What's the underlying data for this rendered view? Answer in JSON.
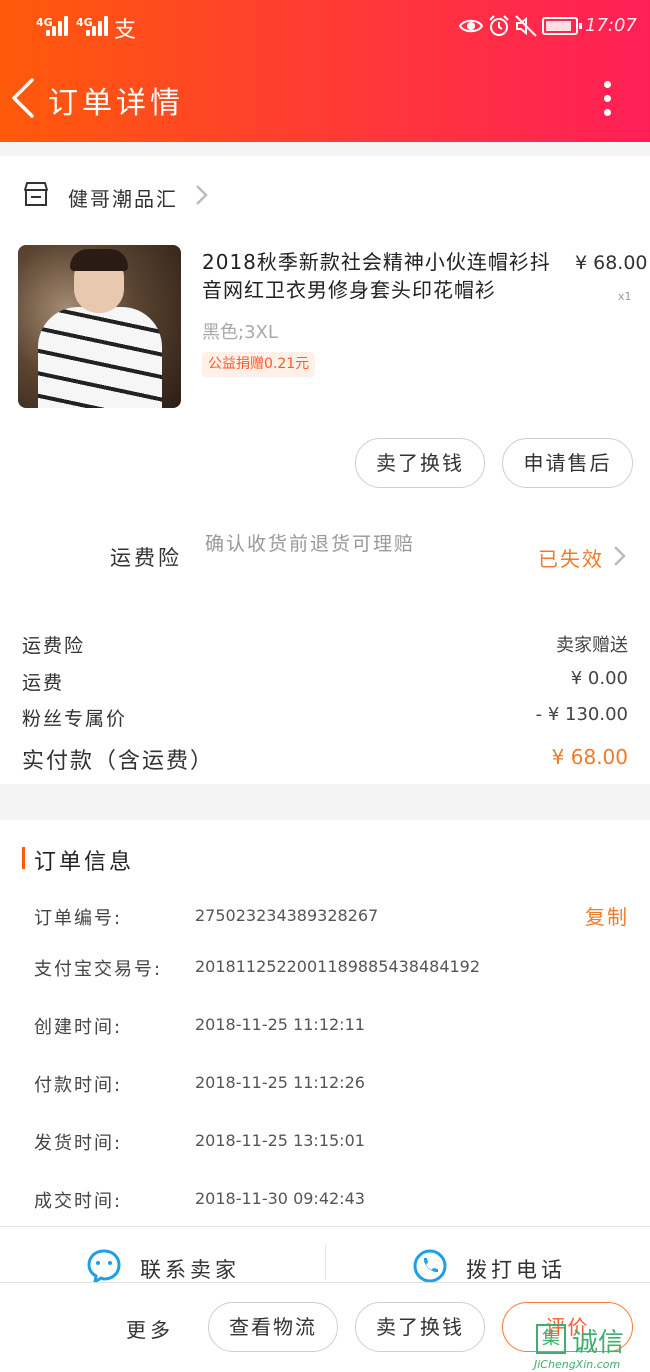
{
  "status_bar": {
    "signal_1": "4G",
    "signal_2": "4G",
    "alipay_glyph": "支",
    "battery_level": "88",
    "time": "17:07",
    "icons": [
      "eye-icon",
      "alarm-icon",
      "mute-icon",
      "battery-icon"
    ]
  },
  "nav": {
    "title": "订单详情",
    "icons": [
      "back-arrow-icon",
      "more-vertical-icon"
    ]
  },
  "shop": {
    "name": "健哥潮品汇",
    "icon": "store-icon"
  },
  "product": {
    "title": "2018秋季新款社会精神小伙连帽衫抖音网红卫衣男修身套头印花帽衫",
    "price": "¥ 68.00",
    "quantity": "x1",
    "sku": "黑色;3XL",
    "charity_badge": "公益捐赠0.21元"
  },
  "item_actions": {
    "resell": "卖了换钱",
    "after_sales": "申请售后"
  },
  "insurance": {
    "label": "运费险",
    "description": "确认收货前退货可理赔",
    "status": "已失效"
  },
  "fees": [
    {
      "label": "运费险",
      "value": "卖家赠送"
    },
    {
      "label": "运费",
      "value": "¥ 0.00"
    },
    {
      "label": "粉丝专属价",
      "value": "- ¥ 130.00"
    }
  ],
  "total": {
    "label": "实付款（含运费）",
    "value": "¥ 68.00"
  },
  "order_info": {
    "title": "订单信息",
    "copy_label": "复制",
    "rows": [
      {
        "label": "订单编号:",
        "value": "275023234389328267"
      },
      {
        "label": "支付宝交易号:",
        "value": "2018112522001189885438484192"
      },
      {
        "label": "创建时间:",
        "value": "2018-11-25  11:12:11"
      },
      {
        "label": "付款时间:",
        "value": "2018-11-25  11:12:26"
      },
      {
        "label": "发货时间:",
        "value": "2018-11-25  13:15:01"
      },
      {
        "label": "成交时间:",
        "value": "2018-11-30  09:42:43"
      }
    ]
  },
  "contact": {
    "seller": "联系卖家",
    "call": "拨打电话"
  },
  "bottom_bar": {
    "more": "更多",
    "logistics": "查看物流",
    "resell": "卖了换钱",
    "evaluate": "评价"
  },
  "watermark": {
    "box_glyph": "集",
    "cn": "诚信",
    "en": "JiChengXin.com"
  },
  "colors": {
    "accent": "#ff5a0a",
    "status_orange": "#f07a2a",
    "price_orange": "#f07a2a"
  }
}
